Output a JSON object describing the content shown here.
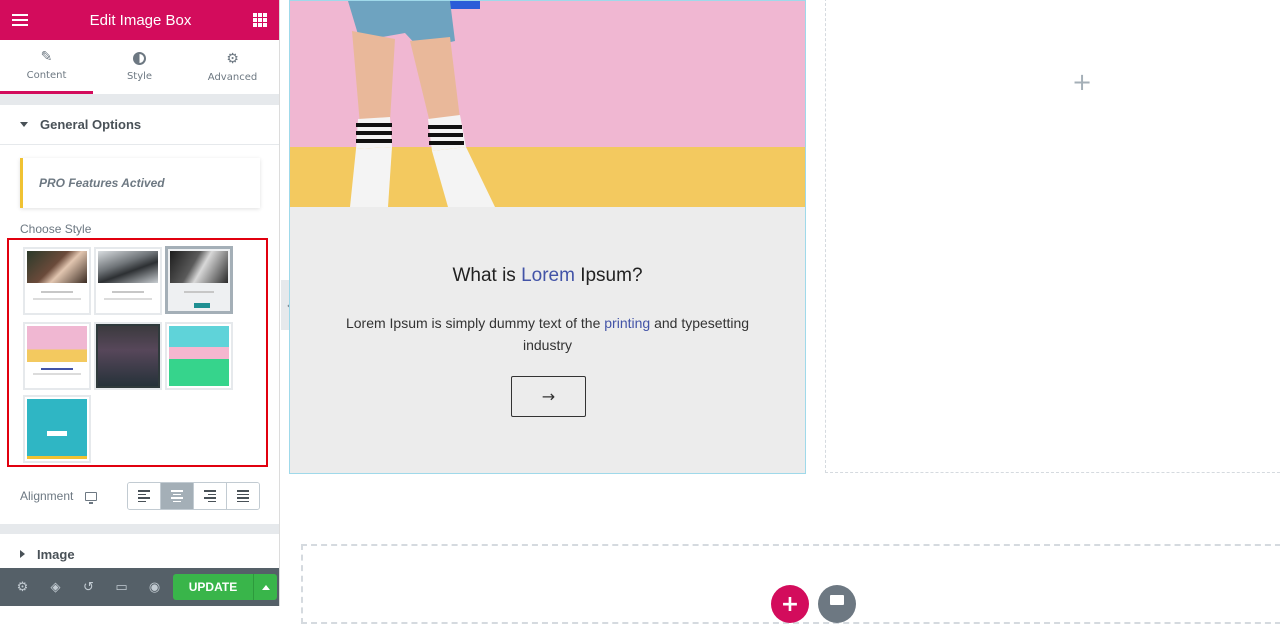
{
  "panel": {
    "title": "Edit Image Box",
    "tabs": [
      {
        "label": "Content",
        "icon": "pencil-icon"
      },
      {
        "label": "Style",
        "icon": "contrast-icon"
      },
      {
        "label": "Advanced",
        "icon": "gear-icon"
      }
    ],
    "general_section": "General Options",
    "pro_notice": "PRO Features Actived",
    "choose_style_label": "Choose Style",
    "style_options_count": 7,
    "selected_style_index": 3,
    "alignment_label": "Alignment",
    "alignment_options": [
      "left",
      "center",
      "right",
      "justify"
    ],
    "alignment_selected": "center",
    "image_section": "Image",
    "footer": {
      "icons": [
        "settings-icon",
        "layers-icon",
        "history-icon",
        "responsive-icon",
        "preview-icon"
      ],
      "update_label": "UPDATE"
    },
    "colors": {
      "brand": "#d30c5c",
      "update": "#39b54a",
      "highlight_border": "#e1000f"
    }
  },
  "canvas": {
    "card": {
      "title_before": "What is ",
      "title_highlight": "Lorem",
      "title_after": " Ipsum?",
      "text_before": "Lorem Ipsum is simply dummy text of the ",
      "text_highlight": "printing",
      "text_after": " and typesetting industry",
      "button_icon": "→",
      "accent_color": "#4253a7"
    },
    "add_icon": "+"
  }
}
